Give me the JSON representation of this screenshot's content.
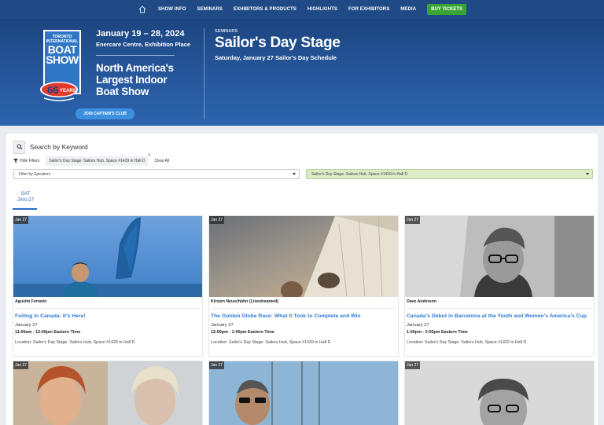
{
  "nav": {
    "items": [
      "SHOW INFO",
      "SEMINARS",
      "EXHIBITORS & PRODUCTS",
      "HIGHLIGHTS",
      "FOR EXHIBITORS",
      "MEDIA"
    ],
    "buy_label": "BUY TICKETS",
    "home_icon": "home-icon"
  },
  "hero": {
    "logo_top": "TORONTO INTERNATIONAL",
    "logo_main": "BOAT SHOW",
    "logo_years_num": "66",
    "logo_years_word": "YEARS",
    "dates": "January 19 – 28, 2024",
    "venue": "Enercare Centre, Exhibition Place",
    "tagline": "North America's Largest Indoor Boat Show",
    "join_label": "JOIN CAPTAIN'S CLUB",
    "eyebrow": "SEMINARS",
    "title": "Sailor's Day Stage",
    "subtitle": "Saturday, January 27 Sailor's Day Schedule"
  },
  "search": {
    "label": "Search by Keyword",
    "icon": "search-icon"
  },
  "filters": {
    "hide_label": "Hide Filters",
    "chip": "Sailor's Day Stage: Sailors Hub, Space #1429 in Hall D",
    "chip_close": "×",
    "clear_all": "Clear All",
    "speakers_placeholder": "Filter by Speakers",
    "location_selected": "Sailor's Day Stage: Sailors Hub, Space #1429 in Hall D"
  },
  "day_tab": {
    "dow": "SAT",
    "date": "JAN 27"
  },
  "cards": [
    {
      "badge": "Jan 27",
      "speaker": "Agustin Ferrario",
      "title": "Foiling in Canada: It's Here!",
      "date": "January 27",
      "time": "11:00am - 12:00pm Eastern Time",
      "location": "Location: Sailor's Day Stage: Sailors Hub, Space #1429 in Hall D"
    },
    {
      "badge": "Jan 27",
      "speaker": "Kirsten Neuschäfer (Livestreamed)",
      "title": "The Golden Globe Race: What It Took to Complete and Win",
      "date": "January 27",
      "time": "12:00pm - 1:00pm Eastern Time",
      "location": "Location: Sailor's Day Stage: Sailors Hub, Space #1429 in Hall D"
    },
    {
      "badge": "Jan 27",
      "speaker": "Dave Anderson",
      "title": "Canada's Debut in Barcelona at the Youth and Women's America's Cup",
      "date": "January 27",
      "time": "1:00pm - 2:00pm Eastern Time",
      "location": "Location: Sailor's Day Stage: Sailors Hub, Space #1429 in Hall D"
    },
    {
      "badge": "Jan 27"
    },
    {
      "badge": "Jan 27"
    },
    {
      "badge": "Jan 27"
    }
  ],
  "colors": {
    "nav_bg": "#1f4a86",
    "hero_bg": "#27579c",
    "buy_green": "#37a533",
    "link_blue": "#2d7ad1",
    "select_green": "#dcebc8"
  }
}
